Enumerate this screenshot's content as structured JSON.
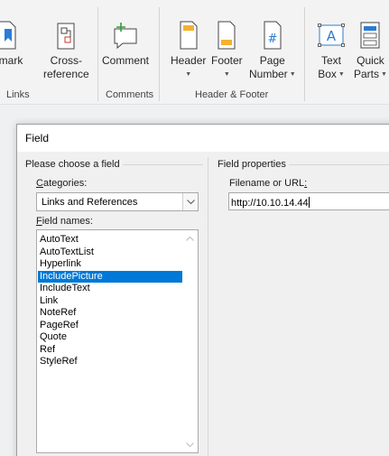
{
  "ribbon": {
    "buttons": [
      {
        "id": "bookmark",
        "label": "okmark",
        "icon": "bookmark-icon"
      },
      {
        "id": "cross_reference",
        "label_line1": "Cross-",
        "label_line2": "reference",
        "icon": "cross-reference-icon"
      },
      {
        "id": "comment",
        "label": "Comment",
        "icon": "comment-icon"
      },
      {
        "id": "header",
        "label": "Header",
        "icon": "header-icon",
        "has_dropdown": true
      },
      {
        "id": "footer",
        "label": "Footer",
        "icon": "footer-icon",
        "has_dropdown": true
      },
      {
        "id": "page_number",
        "label_line1": "Page",
        "label_line2": "Number",
        "icon": "page-number-icon",
        "has_dropdown": true
      },
      {
        "id": "text_box",
        "label_line1": "Text",
        "label_line2": "Box",
        "icon": "text-box-icon",
        "has_dropdown": true
      },
      {
        "id": "quick_parts",
        "label_line1": "Quick",
        "label_line2": "Parts",
        "icon": "quick-parts-icon",
        "has_dropdown": true
      }
    ],
    "groups": {
      "links": "Links",
      "comments": "Comments",
      "header_footer": "Header & Footer"
    },
    "icon_glyphs": {
      "page_number": "#",
      "text_box": "A"
    }
  },
  "dialog": {
    "title": "Field",
    "left_section_title": "Please choose a field",
    "categories_label_accel": "C",
    "categories_label_rest": "ategories:",
    "categories_value": "Links and References",
    "field_names_label_accel": "F",
    "field_names_label_rest": "ield names:",
    "field_names": [
      "AutoText",
      "AutoTextList",
      "Hyperlink",
      "IncludePicture",
      "IncludeText",
      "Link",
      "NoteRef",
      "PageRef",
      "Quote",
      "Ref",
      "StyleRef"
    ],
    "selected_field": "IncludePicture",
    "right_section_title": "Field properties",
    "filename_label_rest": "Filename or URL",
    "filename_label_accel": ":",
    "filename_value": "http://10.10.14.44"
  },
  "colors": {
    "selection": "#0078d7",
    "accent_green": "#2e9e3c",
    "accent_orange": "#f4b12e",
    "accent_blue": "#2b7cd3"
  }
}
